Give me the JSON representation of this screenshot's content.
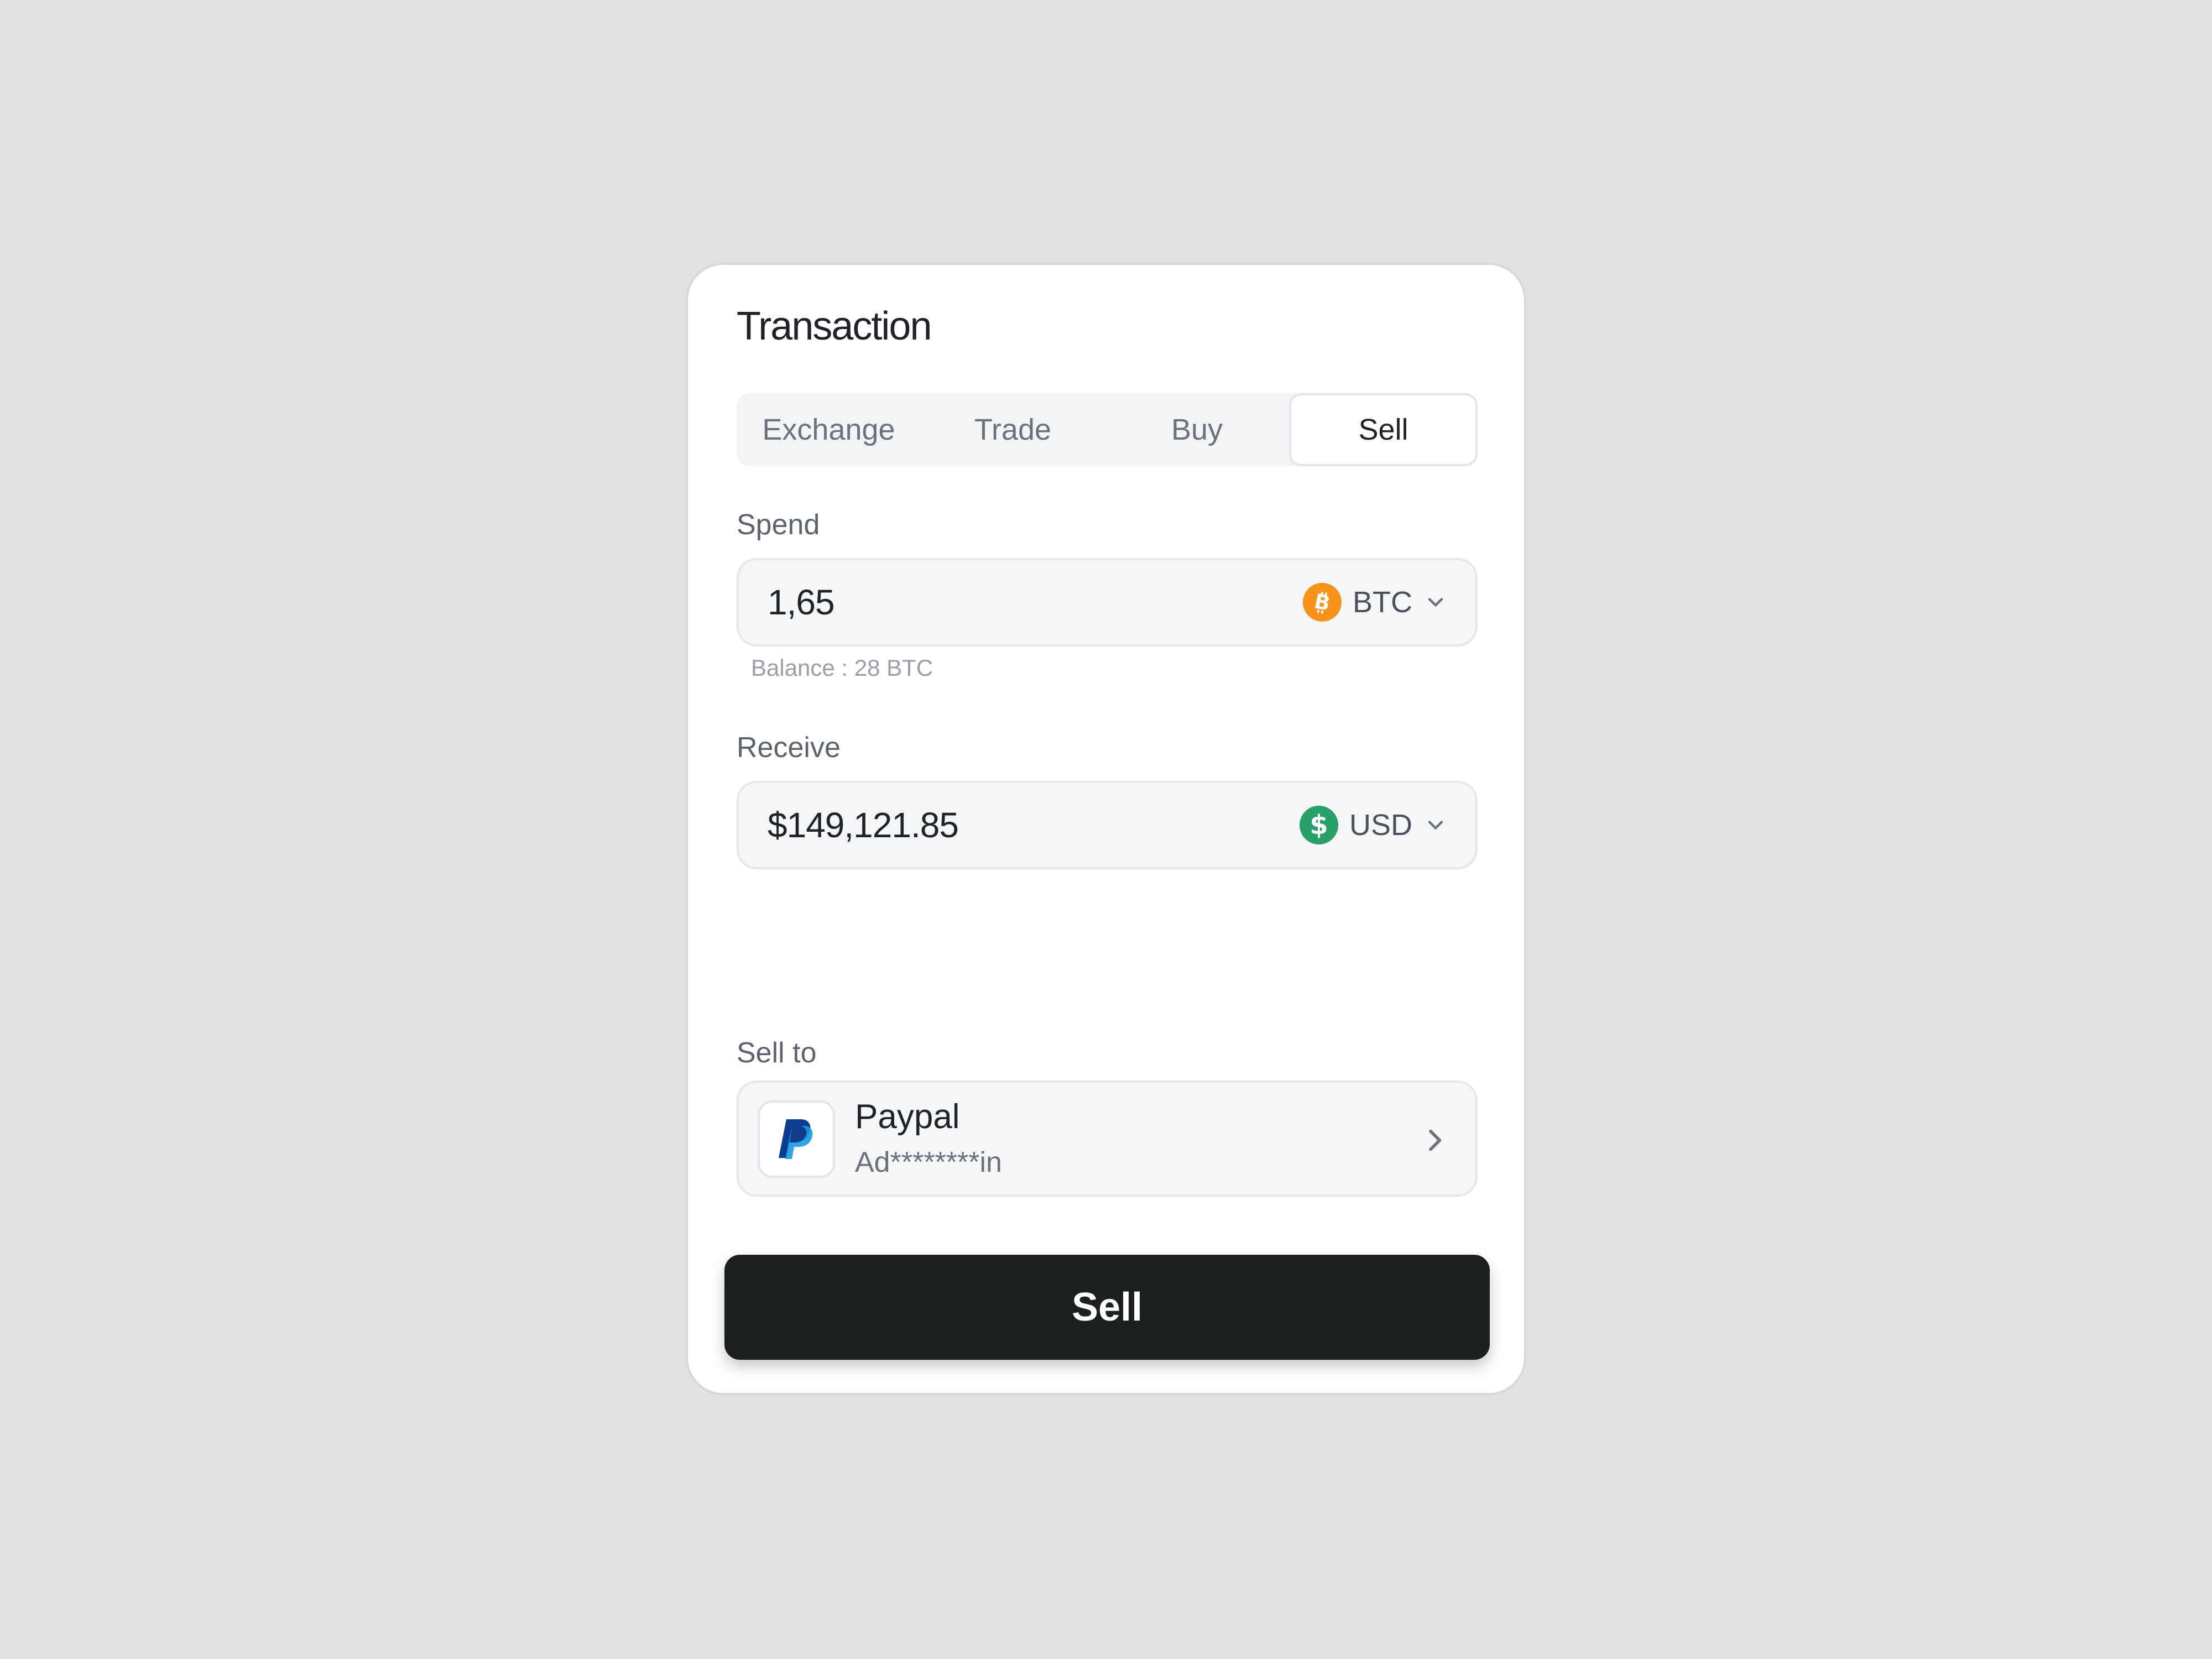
{
  "card": {
    "title": "Transaction"
  },
  "tabs": [
    {
      "label": "Exchange",
      "active": false
    },
    {
      "label": "Trade",
      "active": false
    },
    {
      "label": "Buy",
      "active": false
    },
    {
      "label": "Sell",
      "active": true
    }
  ],
  "spend": {
    "label": "Spend",
    "value": "1,65",
    "currency_code": "BTC",
    "currency_icon": "bitcoin-icon",
    "currency_color": "#f7931a",
    "balance": "Balance :  28 BTC"
  },
  "receive": {
    "label": "Receive",
    "value": "$149,121.85",
    "currency_code": "USD",
    "currency_icon": "dollar-icon",
    "currency_color": "#27a06a"
  },
  "sell_to": {
    "label": "Sell to",
    "provider": "Paypal",
    "account": "Ad********in",
    "provider_icon": "paypal-icon"
  },
  "action": {
    "sell_label": "Sell"
  }
}
